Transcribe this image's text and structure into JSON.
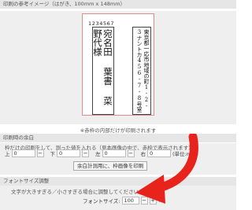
{
  "preview": {
    "header": "印刷の参考イメージ（はがき、100mm x 148mm）",
    "postal_code": "1234567",
    "name_text": "宛名田 葉書 菜野代様",
    "address_text": "東京都一応市地域の町1-2-3ナントカ456-7-8号室",
    "note": "※赤枠の内部だけが印刷されます"
  },
  "margins": {
    "header": "印刷時の余白",
    "description": "枠だけの印刷をして、測った値を入れる（見本画像の中で、赤枠で表示されます）",
    "top_label": "上",
    "top_value": "0",
    "bottom_label": "下",
    "bottom_value": "0",
    "left_label": "左",
    "left_value": "0",
    "right_label": "右",
    "right_value": "0",
    "unit": "(単位:mm)",
    "print_border_button": "余白計測用に、枠画像を印刷"
  },
  "font": {
    "header": "フォントサイズ調整",
    "description": "文字が大きすぎる／小さすぎる場合に調整してください",
    "size_label": "フォントサイズ:",
    "size_value": "100",
    "minus": "−",
    "plus": "+",
    "unit": "%"
  },
  "colors": {
    "accent_red": "#e8231c",
    "card_border": "#e28a8a"
  }
}
